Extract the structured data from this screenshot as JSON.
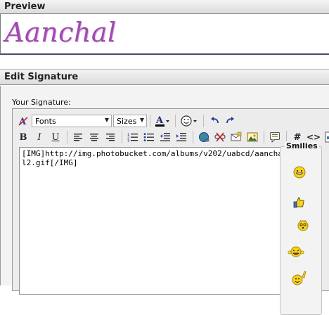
{
  "preview": {
    "header": "Preview",
    "signature_image_text": "Aanchal"
  },
  "edit": {
    "header": "Edit Signature",
    "your_signature_label": "Your Signature:"
  },
  "toolbar": {
    "font_select": "Fonts",
    "size_select": "Sizes",
    "bold": "B",
    "italic": "I",
    "underline": "U",
    "hash": "#",
    "code": "<>"
  },
  "editor": {
    "content": "[IMG]http://img.photobucket.com/albums/v202/uabcd/aanchal2.gif[/IMG]"
  },
  "smilies": {
    "title": "Smilies",
    "icons": [
      "grin-smiley-icon",
      "thumbs-up-smiley-icon",
      "dizzy-smiley-icon",
      "laughing-smiley-icon",
      "pointing-smiley-icon"
    ]
  },
  "colors": {
    "signature": "#a14ab0",
    "header_bg": "#dcdcdc",
    "panel_bg": "#f3f3f3"
  }
}
